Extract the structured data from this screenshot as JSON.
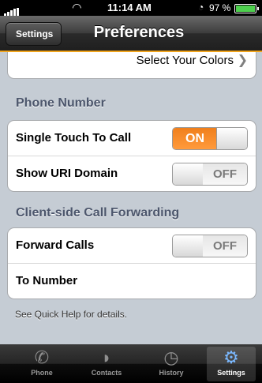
{
  "status_bar": {
    "carrier": "",
    "time": "11:14 AM",
    "battery_percent": "97 %",
    "battery_level": 0.97
  },
  "nav": {
    "back_label": "Settings",
    "title": "Preferences"
  },
  "colors_row": {
    "label": "Select Your Colors"
  },
  "phone_number_section": {
    "header": "Phone Number",
    "rows": [
      {
        "label": "Single Touch To Call",
        "toggle": "ON"
      },
      {
        "label": "Show URI Domain",
        "toggle": "OFF"
      }
    ]
  },
  "forwarding_section": {
    "header": "Client-side Call Forwarding",
    "rows": [
      {
        "label": "Forward Calls",
        "toggle": "OFF"
      },
      {
        "label": "To Number"
      }
    ]
  },
  "footnote": "See Quick Help for details.",
  "tabs": [
    {
      "label": "Phone",
      "icon": "phone-handset-icon",
      "active": false
    },
    {
      "label": "Contacts",
      "icon": "person-icon",
      "active": false
    },
    {
      "label": "History",
      "icon": "clock-icon",
      "active": false
    },
    {
      "label": "Settings",
      "icon": "gears-icon",
      "active": true
    }
  ],
  "accent_color": "#f0a41c",
  "toggle_on_color": "#f07f1c"
}
